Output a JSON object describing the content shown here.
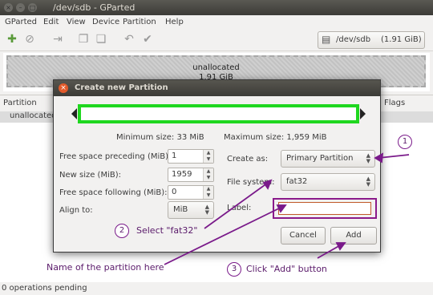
{
  "window": {
    "title": "/dev/sdb - GParted"
  },
  "menu": [
    "GParted",
    "Edit",
    "View",
    "Device",
    "Partition",
    "Help"
  ],
  "toolbar": {
    "device": "/dev/sdb",
    "device_size": "(1.91 GiB)"
  },
  "graphic": {
    "label": "unallocated",
    "size": "1.91 GiB"
  },
  "list": {
    "col_partition": "Partition",
    "col_flags": "Flags",
    "row_partition": "unallocated"
  },
  "status": "0 operations pending",
  "dialog": {
    "title": "Create new Partition",
    "min_size": "Minimum size: 33 MiB",
    "max_size": "Maximum size: 1,959 MiB",
    "free_preceding_label": "Free space preceding (MiB):",
    "free_preceding_value": "1",
    "new_size_label": "New size (MiB):",
    "new_size_value": "1959",
    "free_following_label": "Free space following (MiB):",
    "free_following_value": "0",
    "align_label": "Align to:",
    "align_value": "MiB",
    "create_as_label": "Create as:",
    "create_as_value": "Primary Partition",
    "filesystem_label": "File system:",
    "filesystem_value": "fat32",
    "label_label": "Label:",
    "label_value": "",
    "cancel": "Cancel",
    "add": "Add"
  },
  "annotations": {
    "step1": "1",
    "step2": "2",
    "step2_text": "Select \"fat32\"",
    "step3": "3",
    "step3_text": "Click \"Add\" button",
    "name_text": "Name of the partition here",
    "color": "#7a1a8a",
    "green_highlight": "#1fd71f"
  }
}
